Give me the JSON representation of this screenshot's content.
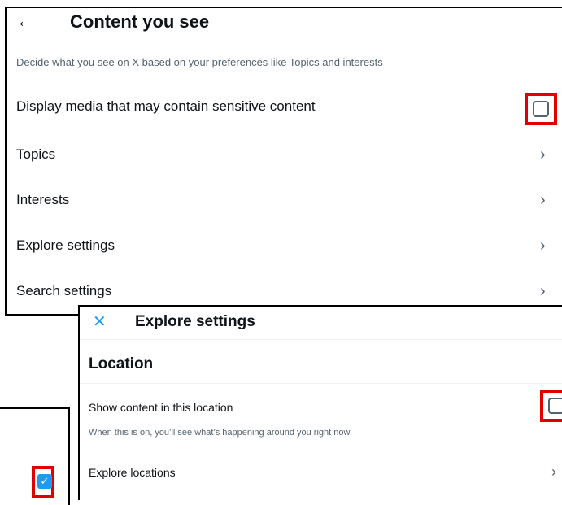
{
  "content_settings": {
    "back_icon": "arrow-left-icon",
    "back_glyph": "←",
    "title": "Content you see",
    "description": "Decide what you see on X based on your preferences like Topics and interests",
    "sensitive_media_label": "Display media that may contain sensitive content",
    "sensitive_media_checked": false,
    "items": [
      {
        "label": "Topics"
      },
      {
        "label": "Interests"
      },
      {
        "label": "Explore settings"
      },
      {
        "label": "Search settings"
      }
    ],
    "chevron_icon": "chevron-right-icon",
    "chevron_glyph": "›"
  },
  "explore_settings": {
    "close_icon": "close-icon",
    "close_glyph": "✕",
    "title": "Explore settings",
    "section_title": "Location",
    "show_location_label": "Show content in this location",
    "show_location_checked": false,
    "show_location_description": "When this is on, you’ll see what’s happening around you right now.",
    "explore_locations_label": "Explore locations",
    "chevron_glyph": "›"
  },
  "partial_panel": {
    "checkbox_checked": true,
    "check_glyph": "✓"
  },
  "colors": {
    "highlight": "#e00000",
    "accent": "#1d9bf0",
    "text_primary": "#0f1419",
    "text_secondary": "#536471"
  }
}
